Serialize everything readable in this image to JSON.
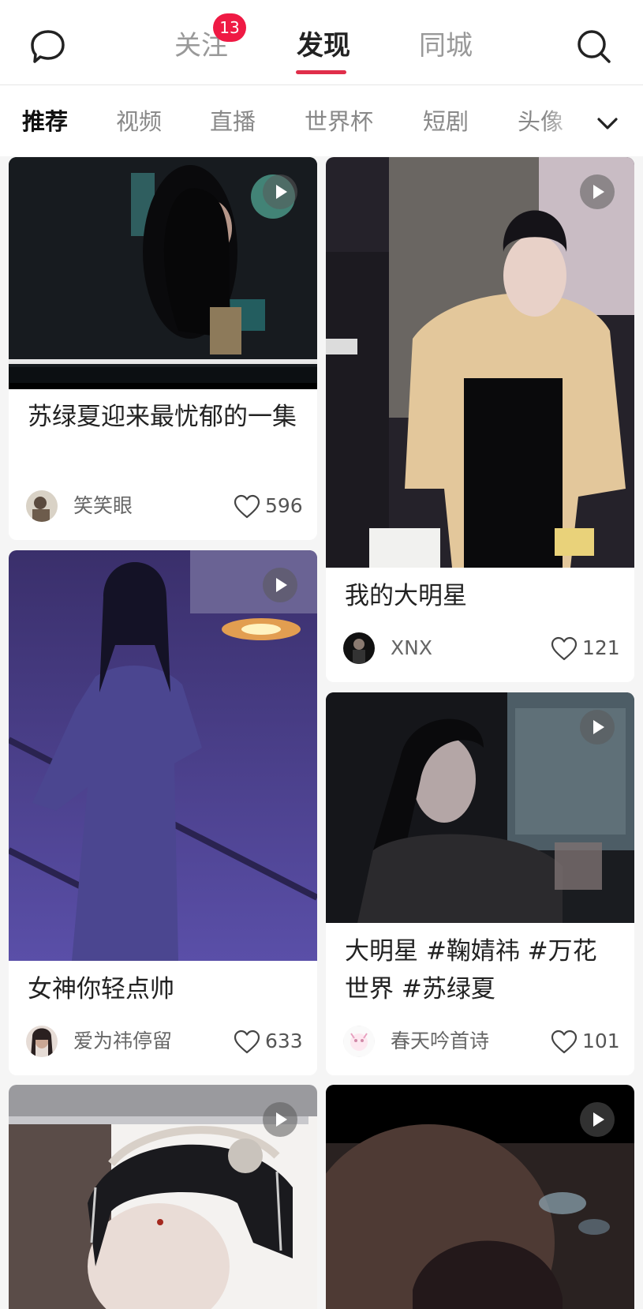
{
  "nav": {
    "tabs": [
      {
        "label": "关注",
        "badge": "13"
      },
      {
        "label": "发现",
        "active": true
      },
      {
        "label": "同城"
      }
    ]
  },
  "channels": {
    "items": [
      "推荐",
      "视频",
      "直播",
      "世界杯",
      "短剧",
      "头像"
    ],
    "active": "推荐"
  },
  "feed": [
    {
      "title": "苏绿夏迎来最忧郁的一集",
      "author": "笑笑眼",
      "likes": "596",
      "type": "video"
    },
    {
      "title": "我的大明星",
      "author": "XNX",
      "likes": "121",
      "type": "video"
    },
    {
      "title": "女神你轻点帅",
      "author": "爱为祎停留",
      "likes": "633",
      "type": "video"
    },
    {
      "title": "大明星 #鞠婧祎 #万花世界 #苏绿夏",
      "author": "春天吟首诗",
      "likes": "101",
      "type": "video"
    },
    {
      "title": "",
      "author": "",
      "likes": "",
      "type": "video"
    },
    {
      "title": "",
      "author": "",
      "likes": "",
      "type": "video"
    }
  ],
  "colors": {
    "accent": "#e02e4a",
    "badge": "#ef1a44"
  },
  "icons": {
    "message": "chat-bubble-icon",
    "search": "search-icon",
    "more": "chevron-down-icon",
    "play": "play-icon",
    "like": "heart-icon"
  }
}
